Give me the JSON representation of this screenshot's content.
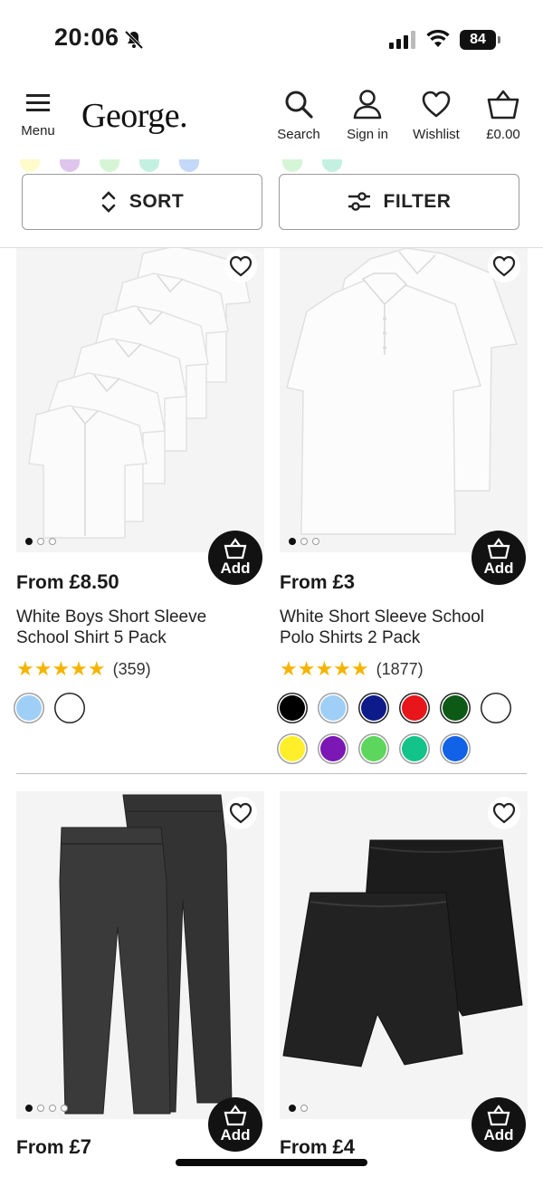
{
  "status_bar": {
    "time": "20:06",
    "battery": "84"
  },
  "header": {
    "menu_label": "Menu",
    "logo_text": "George",
    "search_label": "Search",
    "signin_label": "Sign in",
    "wishlist_label": "Wishlist",
    "basket_total": "£0.00"
  },
  "toolbar": {
    "sort_label": "SORT",
    "filter_label": "FILTER"
  },
  "products": [
    {
      "from_label": "From",
      "price": "£8.50",
      "title_line1": "White Boys Short Sleeve",
      "title_line2": "School Shirt 5 Pack",
      "rating": 5,
      "reviews": "(359)",
      "add_label": "Add",
      "swatch_colors": [
        "#9fcff7",
        "#ffffff"
      ]
    },
    {
      "from_label": "From",
      "price": "£3",
      "title_line1": "White Short Sleeve School",
      "title_line2": "Polo Shirts 2 Pack",
      "rating": 5,
      "reviews": "(1877)",
      "add_label": "Add",
      "swatch_colors": [
        "#000000",
        "#9fcff7",
        "#0d1a8a",
        "#e8151b",
        "#0d5a16",
        "#ffffff",
        "#ffef2a",
        "#7a17b5",
        "#5cd65c",
        "#12c38a",
        "#1262e8"
      ]
    },
    {
      "from_label": "From",
      "price": "£7",
      "add_label": "Add"
    },
    {
      "from_label": "From",
      "price": "£4",
      "add_label": "Add"
    }
  ],
  "colors": {
    "accent_star": "#f5b400",
    "add_button": "#121212",
    "logo_dot": "#7ab800"
  }
}
